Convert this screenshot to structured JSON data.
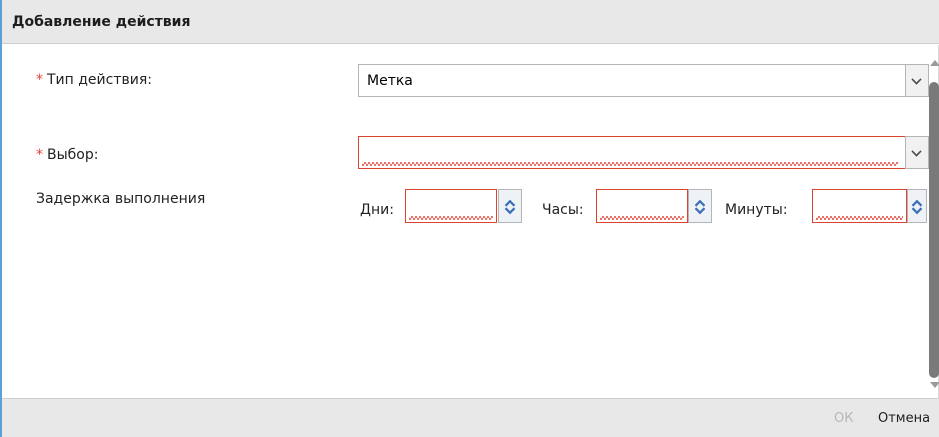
{
  "window": {
    "title": "Добавление действия"
  },
  "form": {
    "required_mark": "*",
    "action_type": {
      "label": "Тип действия:",
      "value": "Метка"
    },
    "choice": {
      "label": "Выбор:",
      "value": ""
    },
    "delay": {
      "label": "Задержка выполнения",
      "days_label": "Дни:",
      "hours_label": "Часы:",
      "minutes_label": "Минуты:",
      "days_value": "",
      "hours_value": "",
      "minutes_value": ""
    }
  },
  "footer": {
    "ok_label": "ОК",
    "cancel_label": "Отмена"
  },
  "icons": [
    "chevron-down-icon",
    "spinner-up-icon",
    "spinner-down-icon"
  ],
  "colors": {
    "accent": "#5f9fd6",
    "required": "#e0443a",
    "invalid_border": "#d9432f",
    "spinner_arrow": "#3b6fb6"
  }
}
